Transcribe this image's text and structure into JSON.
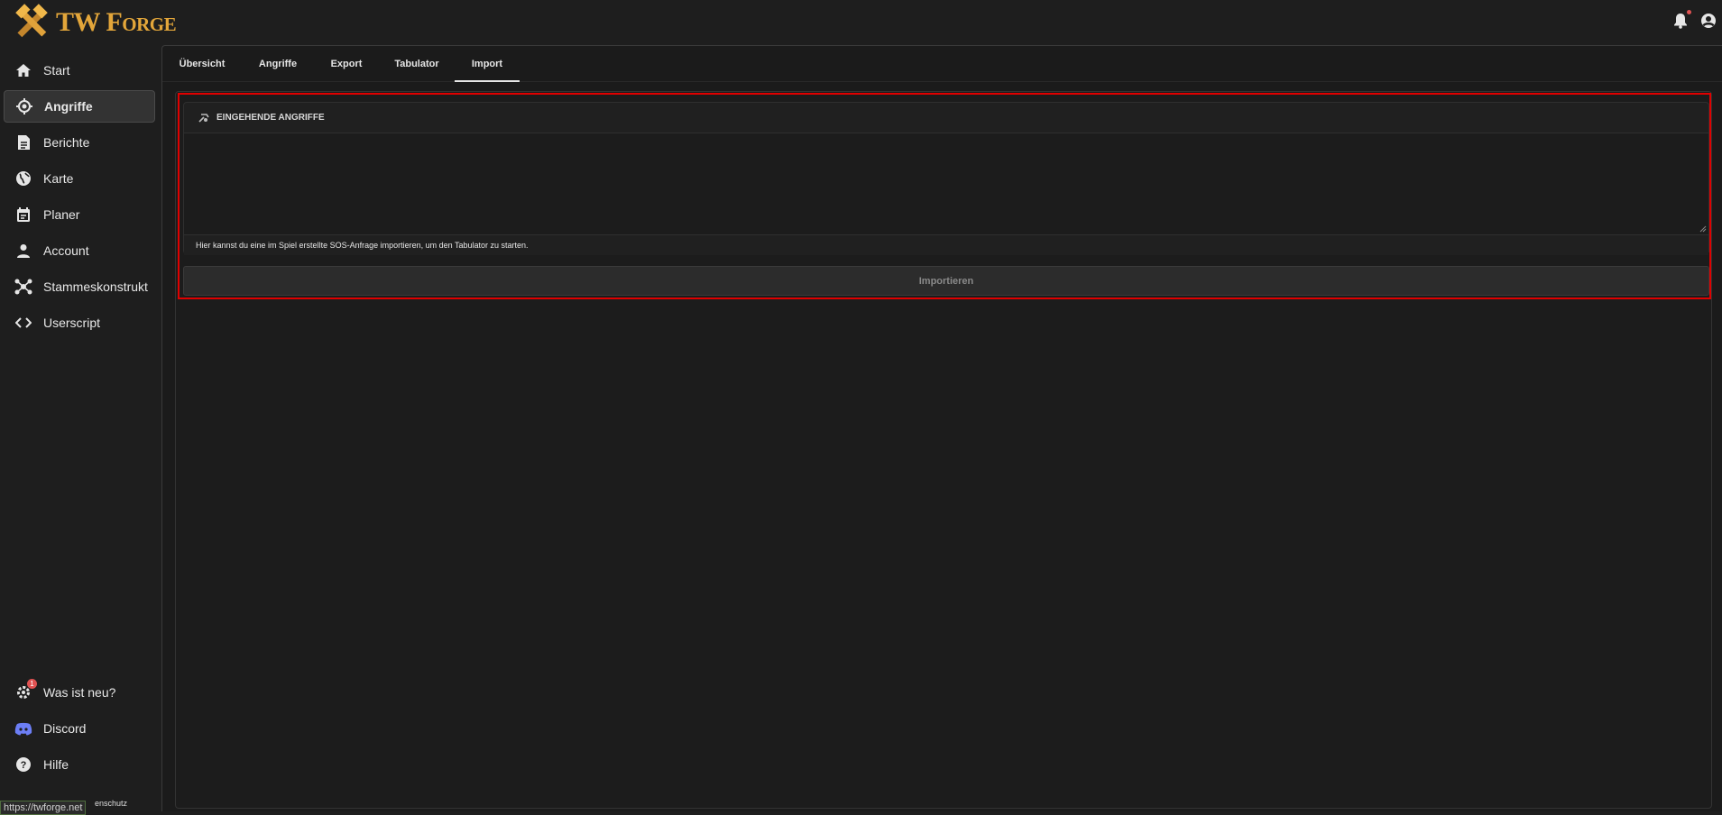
{
  "app": {
    "logo_text": "TW Forge"
  },
  "sidebar": {
    "items": [
      {
        "label": "Start",
        "icon": "home-icon"
      },
      {
        "label": "Angriffe",
        "icon": "target-icon",
        "active": true
      },
      {
        "label": "Berichte",
        "icon": "report-icon"
      },
      {
        "label": "Karte",
        "icon": "globe-icon"
      },
      {
        "label": "Planer",
        "icon": "calendar-icon"
      },
      {
        "label": "Account",
        "icon": "user-icon"
      },
      {
        "label": "Stammeskonstrukt",
        "icon": "network-icon"
      },
      {
        "label": "Userscript",
        "icon": "code-icon"
      }
    ],
    "bottom_items": [
      {
        "label": "Was ist neu?",
        "icon": "gear-icon",
        "badge": "1"
      },
      {
        "label": "Discord",
        "icon": "discord-icon"
      },
      {
        "label": "Hilfe",
        "icon": "help-icon"
      }
    ],
    "url_hint": "https://twforge.net",
    "footer_privacy": "enschutz"
  },
  "tabs": [
    {
      "label": "Übersicht"
    },
    {
      "label": "Angriffe"
    },
    {
      "label": "Export"
    },
    {
      "label": "Tabulator"
    },
    {
      "label": "Import",
      "active": true
    }
  ],
  "import_card": {
    "title": "EINGEHENDE ANGRIFFE",
    "textarea_value": "",
    "hint": "Hier kannst du eine im Spiel erstellte SOS-Anfrage importieren, um den Tabulator zu starten.",
    "button_label": "Importieren"
  },
  "colors": {
    "accent": "#e3a63a",
    "highlight": "#e00000",
    "background": "#1e1e1e"
  }
}
